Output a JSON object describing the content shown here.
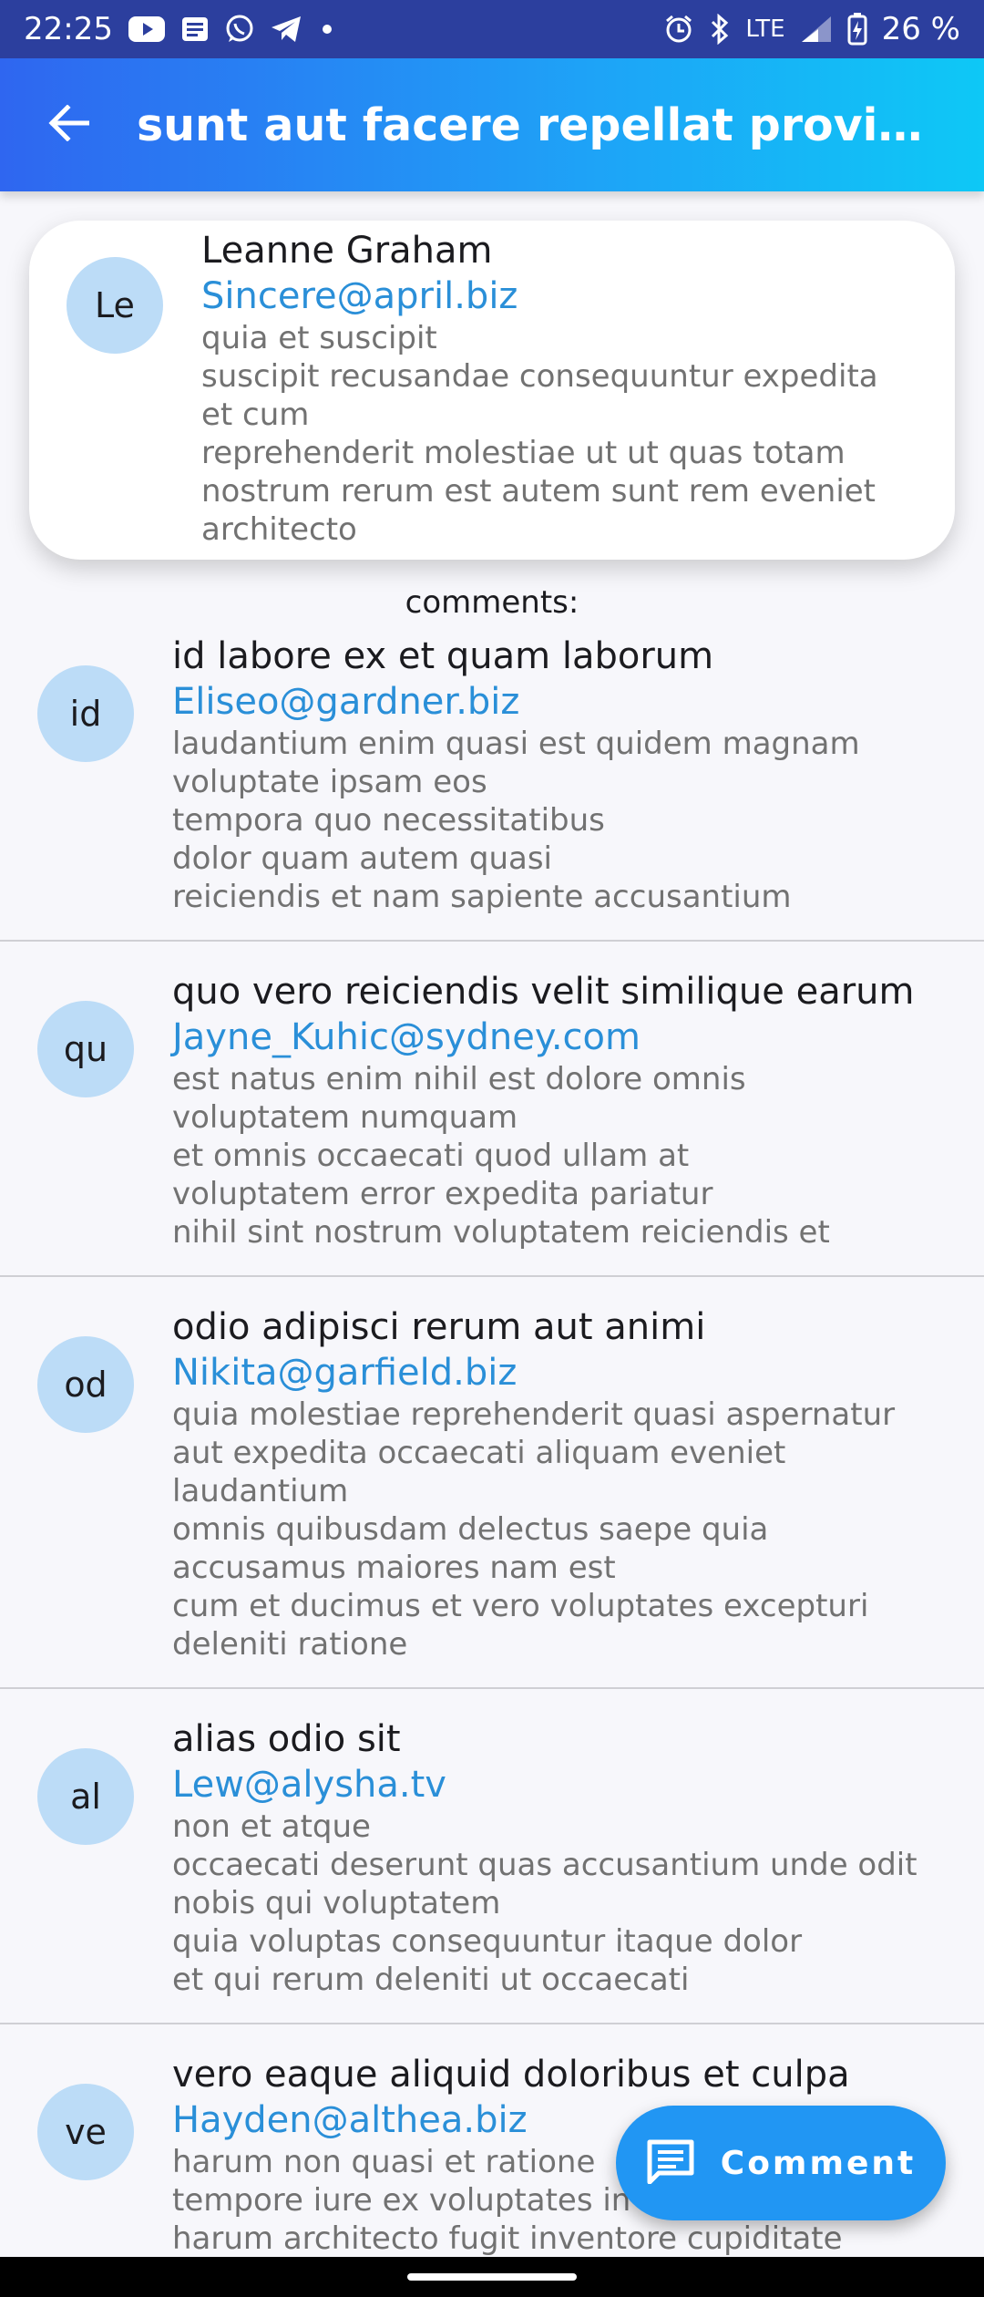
{
  "status_bar": {
    "time": "22:25",
    "network": "LTE",
    "battery": "26 %",
    "icons": [
      "youtube-icon",
      "news-icon",
      "whatsapp-icon",
      "telegram-icon",
      "dot-icon",
      "alarm-icon",
      "bluetooth-icon",
      "signal-icon",
      "battery-charging-icon"
    ]
  },
  "app_bar": {
    "title": "sunt aut facere repellat provident occaecati excepturi optio reprehenderit",
    "back_icon": "arrow-back-icon"
  },
  "post": {
    "avatar": "Le",
    "name": "Leanne Graham",
    "email": "Sincere@april.biz",
    "body": "quia et suscipit\nsuscipit recusandae consequuntur expedita et cum\nreprehenderit molestiae ut ut quas totam\nnostrum rerum est autem sunt rem eveniet architecto"
  },
  "comments_label": "comments:",
  "comments": [
    {
      "avatar": "id",
      "title": "id labore ex et quam laborum",
      "email": "Eliseo@gardner.biz",
      "body": "laudantium enim quasi est quidem magnam voluptate ipsam eos\ntempora quo necessitatibus\ndolor quam autem quasi\nreiciendis et nam sapiente accusantium"
    },
    {
      "avatar": "qu",
      "title": "quo vero reiciendis velit similique earum",
      "email": "Jayne_Kuhic@sydney.com",
      "body": "est natus enim nihil est dolore omnis voluptatem numquam\net omnis occaecati quod ullam at\nvoluptatem error expedita pariatur\nnihil sint nostrum voluptatem reiciendis et"
    },
    {
      "avatar": "od",
      "title": "odio adipisci rerum aut animi",
      "email": "Nikita@garfield.biz",
      "body": "quia molestiae reprehenderit quasi aspernatur\naut expedita occaecati aliquam eveniet laudantium\nomnis quibusdam delectus saepe quia accusamus maiores nam est\ncum et ducimus et vero voluptates excepturi deleniti ratione"
    },
    {
      "avatar": "al",
      "title": "alias odio sit",
      "email": "Lew@alysha.tv",
      "body": "non et atque\noccaecati deserunt quas accusantium unde odit nobis qui voluptatem\nquia voluptas consequuntur itaque dolor\net qui rerum deleniti ut occaecati"
    },
    {
      "avatar": "ve",
      "title": "vero eaque aliquid doloribus et culpa",
      "email": "Hayden@althea.biz",
      "body": "harum non quasi et ratione\ntempore iure ex voluptates in ratione\nharum architecto fugit inventore cupiditate\nvoluptates magni quo et"
    }
  ],
  "fab": {
    "label": "Comment",
    "icon": "comment-icon"
  },
  "colors": {
    "status_bar": "#2c3f9e",
    "app_bar_start": "#2f66f0",
    "app_bar_end": "#0ec8f6",
    "accent": "#2196f3",
    "email": "#2a8fd8",
    "avatar_bg": "#bcdcf7"
  }
}
